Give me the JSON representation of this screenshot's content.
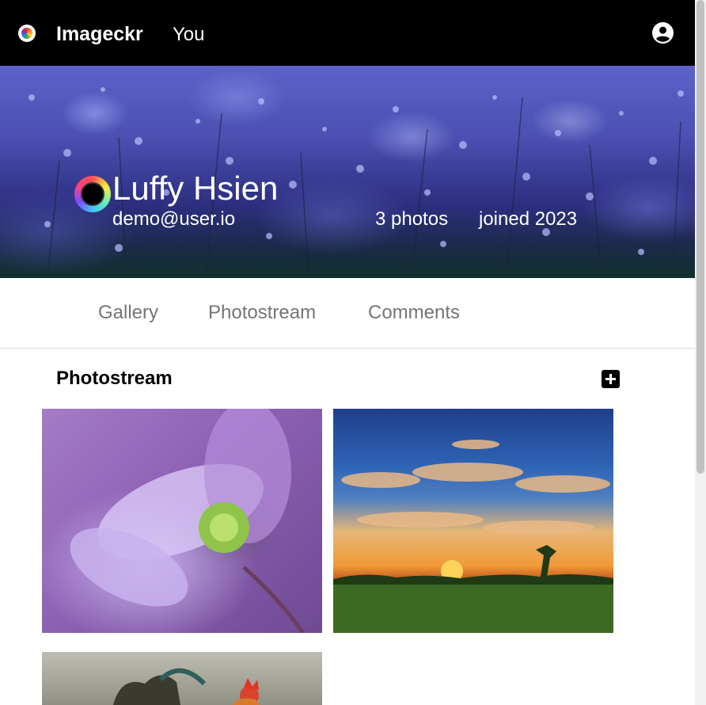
{
  "header": {
    "brand": "Imageckr",
    "nav_you": "You",
    "logo_icon": "imageckr-logo-icon",
    "account_icon": "account-circle-icon",
    "background": "#000000"
  },
  "profile": {
    "name": "Luffy Hsien",
    "email": "demo@user.io",
    "photos_count": "3 photos",
    "joined": "joined 2023",
    "avatar_icon": "avatar-ring-icon"
  },
  "tabs": [
    {
      "label": "Gallery"
    },
    {
      "label": "Photostream"
    },
    {
      "label": "Comments"
    }
  ],
  "section": {
    "title": "Photostream",
    "add_icon": "plus-square-icon"
  },
  "photos": [
    {
      "subject": "purple flower"
    },
    {
      "subject": "sunset over field"
    },
    {
      "subject": "rooster"
    }
  ],
  "colors": {
    "tab_text": "#757575",
    "banner_tone": "#4a4fb0"
  }
}
